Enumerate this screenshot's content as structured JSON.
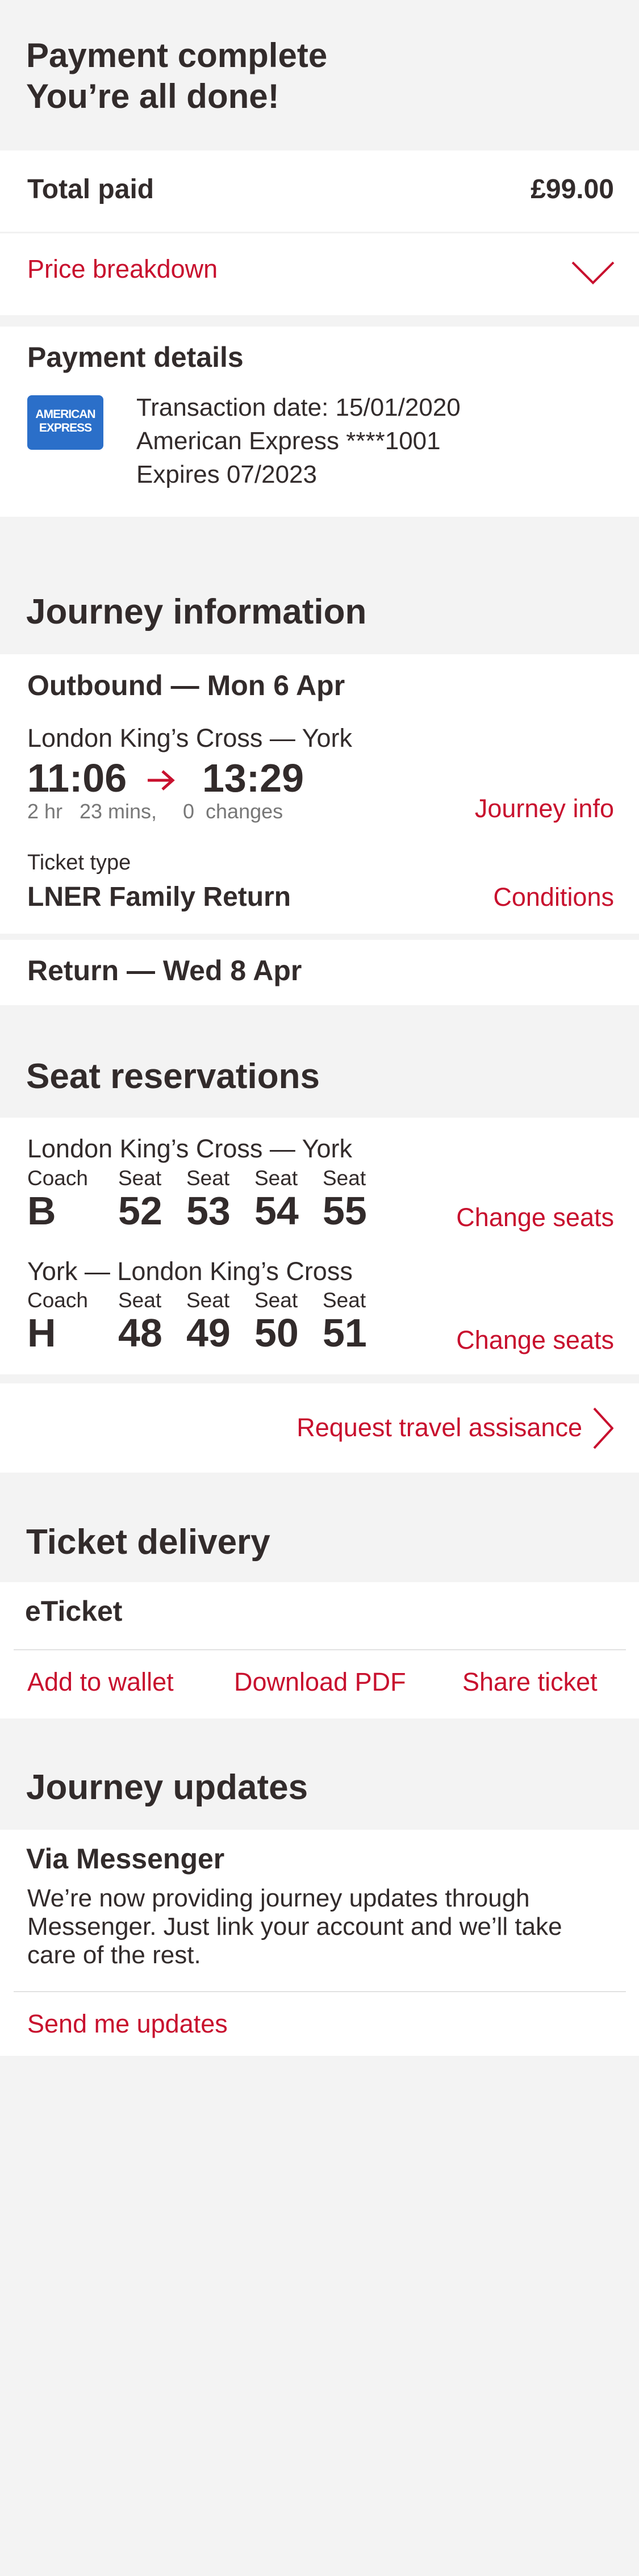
{
  "header": {
    "title_line1": "Payment complete",
    "title_line2": "You’re all done!"
  },
  "payment_summary": {
    "total_label": "Total paid",
    "total_value": "£99.00",
    "breakdown_label": "Price breakdown"
  },
  "payment_details": {
    "heading": "Payment details",
    "card_logo_line1": "AMERICAN",
    "card_logo_line2": "EXPRESS",
    "transaction_date": "Transaction date: 15/01/2020",
    "card_name": "American Express ****1001",
    "expires": "Expires 07/2023"
  },
  "journey": {
    "heading": "Journey information",
    "outbound_title": "Outbound — Mon 6 Apr",
    "route": "London King’s Cross — York",
    "depart_time": "11:06",
    "arrow": "→",
    "arrive_time": "13:29",
    "duration_hr": "2 hr",
    "duration_min": "23 mins,",
    "changes": "0  changes",
    "journey_info_link": "Journey info",
    "ticket_type_label": "Ticket type",
    "ticket_type_value": "LNER Family Return",
    "conditions_link": "Conditions",
    "return_title": "Return — Wed 8 Apr"
  },
  "seats": {
    "heading": "Seat reservations",
    "reservations": [
      {
        "route": "London King’s Cross — York",
        "coach_label": "Coach",
        "coach": "B",
        "seat_label": "Seat",
        "seats": [
          "52",
          "53",
          "54",
          "55"
        ],
        "change_link": "Change seats"
      },
      {
        "route": "York — London King’s Cross",
        "coach_label": "Coach",
        "coach": "H",
        "seat_label": "Seat",
        "seats": [
          "48",
          "49",
          "50",
          "51"
        ],
        "change_link": "Change seats"
      }
    ],
    "assistance_link": "Request travel assisance"
  },
  "delivery": {
    "heading": "Ticket delivery",
    "type": "eTicket",
    "add_wallet": "Add to wallet",
    "download_pdf": "Download PDF",
    "share_ticket": "Share ticket"
  },
  "updates": {
    "heading": "Journey updates",
    "subheading": "Via Messenger",
    "body_line1": "We’re now providing journey updates through",
    "body_line2": "Messenger. Just link your account and we’ll take",
    "body_line3": "care of the rest.",
    "send_link": "Send me updates"
  },
  "colors": {
    "accent": "#c8102e",
    "text": "#322b2b",
    "background": "#f3f3f3",
    "card": "#ffffff",
    "amex_blue": "#2b6fc9"
  }
}
